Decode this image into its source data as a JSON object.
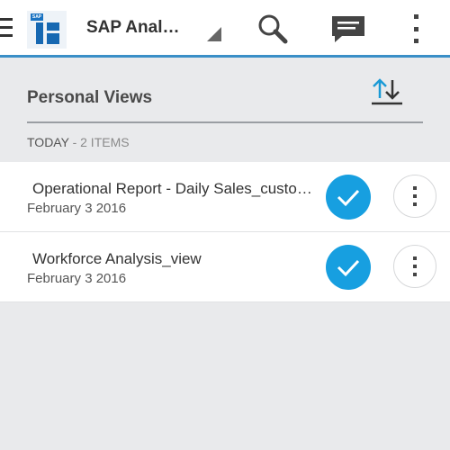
{
  "app": {
    "title": "SAP Anal…",
    "logo_badge": "SAP",
    "accent_color": "#3a8fc7"
  },
  "toolbar": {
    "menu_icon": "hamburger-menu-icon",
    "dropdown_icon": "dropdown-triangle-icon",
    "search_icon": "search-icon",
    "chat_icon": "chat-icon",
    "overflow_icon": "overflow-menu-icon"
  },
  "section": {
    "title": "Personal Views",
    "sort_icon": "sort-icon"
  },
  "group": {
    "label": "TODAY",
    "count": " - 2 ITEMS"
  },
  "items": [
    {
      "title": "Operational Report - Daily Sales_customer view",
      "date": "February 3 2016",
      "selected": true
    },
    {
      "title": "Workforce Analysis_view",
      "date": "February 3 2016",
      "selected": true
    }
  ],
  "colors": {
    "check_button": "#179fe0",
    "background": "#e9eaec"
  }
}
